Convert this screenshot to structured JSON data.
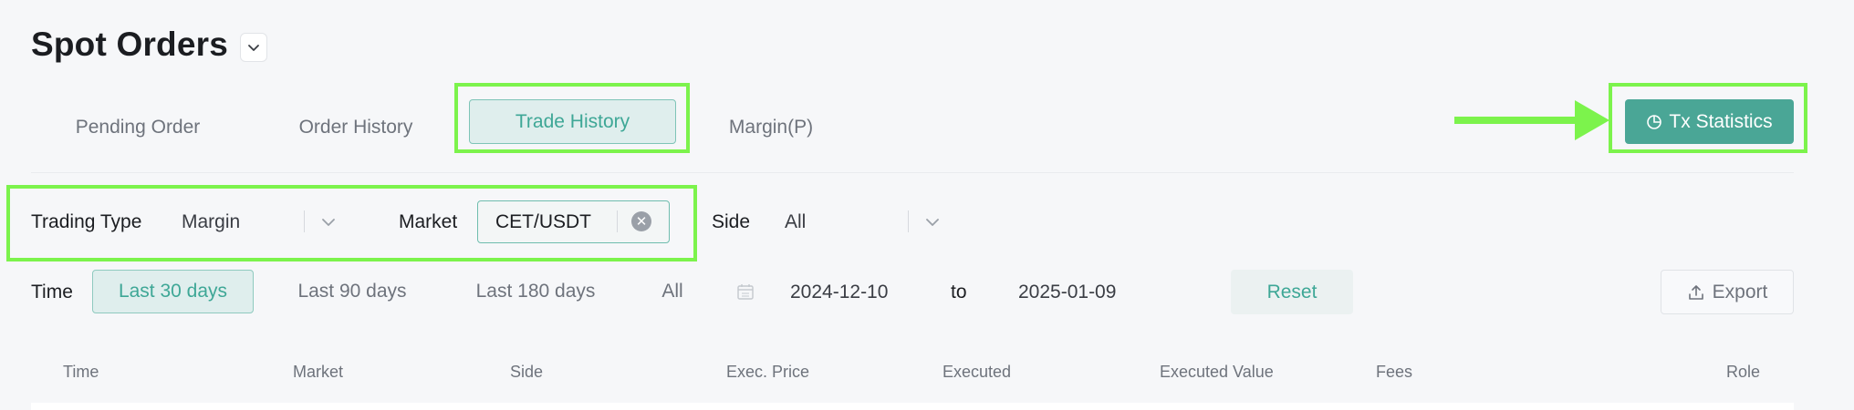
{
  "header": {
    "title": "Spot Orders"
  },
  "tabs": [
    {
      "label": "Pending Order"
    },
    {
      "label": "Order History"
    },
    {
      "label": "Trade History",
      "active": true
    },
    {
      "label": "Margin(P)"
    }
  ],
  "actions": {
    "tx_statistics_label": "Tx Statistics"
  },
  "filters": {
    "trading_type_label": "Trading Type",
    "trading_type_value": "Margin",
    "market_label": "Market",
    "market_value": "CET/USDT",
    "side_label": "Side",
    "side_value": "All"
  },
  "time_filter": {
    "label": "Time",
    "options": [
      "Last 30 days",
      "Last 90 days",
      "Last 180 days",
      "All"
    ],
    "selected": "Last 30 days",
    "start_date": "2024-12-10",
    "to_label": "to",
    "end_date": "2025-01-09",
    "reset_label": "Reset",
    "export_label": "Export"
  },
  "table": {
    "columns": [
      "Time",
      "Market",
      "Side",
      "Exec. Price",
      "Executed",
      "Executed Value",
      "Fees",
      "Role"
    ]
  },
  "colors": {
    "accent": "#4aa696",
    "accent_text": "#3ea796",
    "highlight": "#7cf34c"
  },
  "icons": [
    "chevron-down-icon",
    "pie-chart-icon",
    "clear-icon",
    "calendar-icon",
    "upload-icon",
    "annotation-arrow"
  ]
}
